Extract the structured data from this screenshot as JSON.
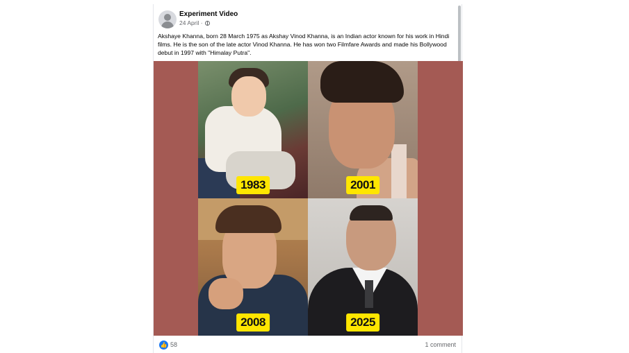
{
  "post": {
    "author": "Experiment Video",
    "date": "24 April ·",
    "caption": "Akshaye Khanna, born 28 March 1975 as Akshay Vinod Khanna, is an Indian actor known for his work in Hindi films. He is the son of the late actor Vinod Khanna. He has won two Filmfare Awards and made his Bollywood debut in 1997 with \"Himalay Putra\".",
    "photos": [
      {
        "year": "1983"
      },
      {
        "year": "2001"
      },
      {
        "year": "2008"
      },
      {
        "year": "2025"
      }
    ],
    "reactions": "58",
    "comments": "1 comment"
  },
  "icons": {
    "avatar": "default-avatar-icon",
    "privacy": "globe-icon",
    "like": "like-thumb-icon"
  },
  "colors": {
    "media_background": "#a45a54",
    "year_badge": "#ffe600",
    "like_blue": "#1877f2"
  }
}
